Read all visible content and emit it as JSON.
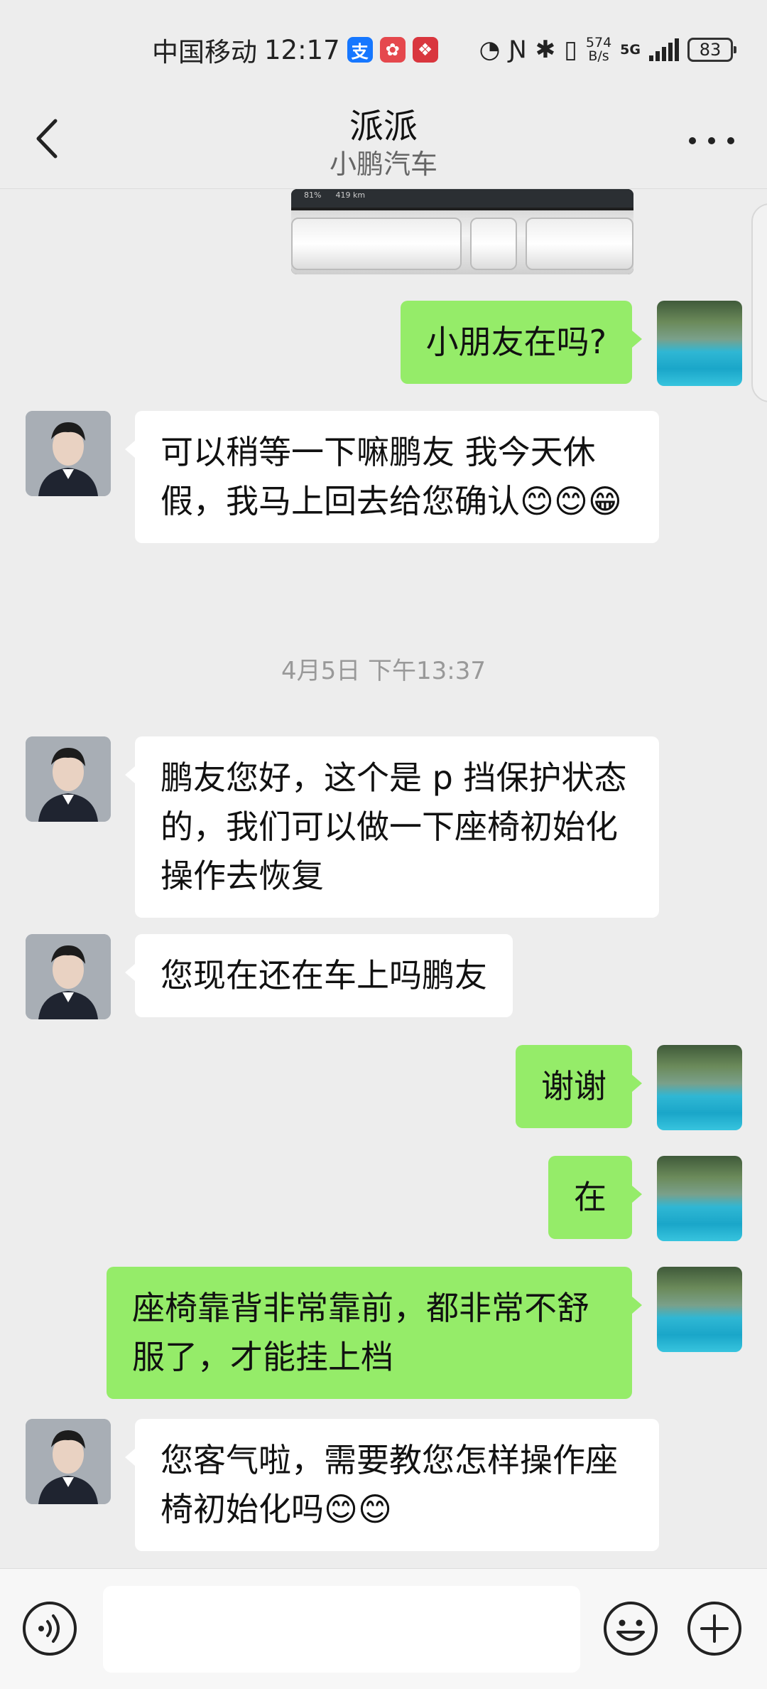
{
  "status_bar": {
    "carrier": "中国移动",
    "time": "12:17",
    "app_icons": [
      "alipay-icon",
      "app-red-icon",
      "app-red2-icon"
    ],
    "net_speed_value": "574",
    "net_speed_unit": "B/s",
    "network": "5G",
    "battery": "83"
  },
  "header": {
    "title": "派派",
    "subtitle": "小鹏汽车"
  },
  "image_preview": {
    "text_a": "81%",
    "text_b": "419 km"
  },
  "messages": [
    {
      "id": "m1",
      "side": "out",
      "text": "小朋友在吗?"
    },
    {
      "id": "m2",
      "side": "in",
      "text": "可以稍等一下嘛鹏友 我今天休假，我马上回去给您确认😊😊😁"
    },
    {
      "id": "m3",
      "side": "in",
      "text": "鹏友您好，这个是 p 挡保护状态的，我们可以做一下座椅初始化操作去恢复"
    },
    {
      "id": "m4",
      "side": "in",
      "text": "您现在还在车上吗鹏友"
    },
    {
      "id": "m5",
      "side": "out",
      "text": "谢谢"
    },
    {
      "id": "m6",
      "side": "out",
      "text": "在"
    },
    {
      "id": "m7",
      "side": "out",
      "text": "座椅靠背非常靠前，都非常不舒服了，才能挂上档"
    },
    {
      "id": "m8",
      "side": "in",
      "text": "您客气啦，需要教您怎样操作座椅初始化吗😊😊"
    }
  ],
  "timestamp": "4月5日 下午13:37",
  "input_bar": {
    "value": "",
    "icons": [
      "voice-icon",
      "emoji-icon",
      "plus-icon"
    ]
  },
  "colors": {
    "background": "#ededed",
    "outgoing_bubble": "#95ec69",
    "incoming_bubble": "#ffffff"
  }
}
